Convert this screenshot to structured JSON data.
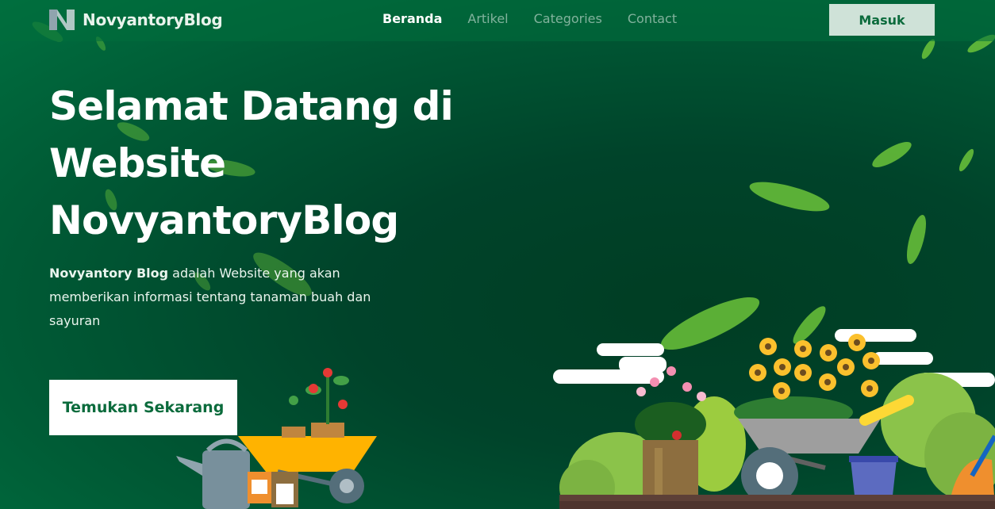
{
  "brand": {
    "name": "NovyantoryBlog",
    "logo_icon": "n-logo-icon"
  },
  "nav": {
    "items": [
      {
        "label": "Beranda",
        "active": true
      },
      {
        "label": "Artikel",
        "active": false
      },
      {
        "label": "Categories",
        "active": false
      },
      {
        "label": "Contact",
        "active": false
      }
    ],
    "login_label": "Masuk"
  },
  "hero": {
    "title_lines": [
      "Selamat Datang di",
      "Website",
      "NovyantoryBlog"
    ],
    "desc_bold": "Novyantory Blog",
    "desc_rest": " adalah Website yang akan memberikan informasi tentang tanaman buah dan sayuran",
    "cta_label": "Temukan Sekarang"
  },
  "colors": {
    "background": "#005a35",
    "accent": "#0b6b3c",
    "login_bg": "#cfe2d8",
    "leaf": "#5fbf2e"
  }
}
